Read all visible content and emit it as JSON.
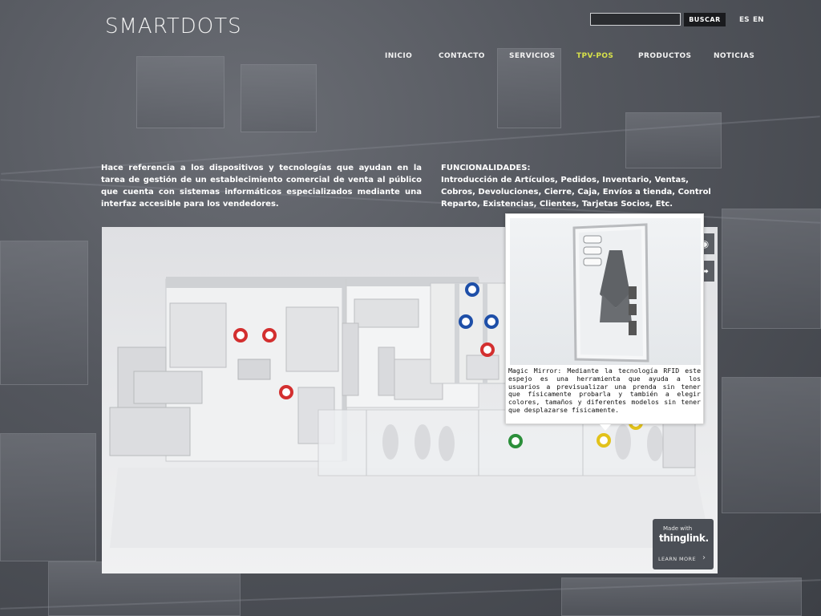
{
  "header": {
    "logo": "SMARTDOTS",
    "search": {
      "placeholder": "",
      "button_label": "BUSCAR"
    },
    "languages": [
      "ES",
      "EN"
    ]
  },
  "nav": {
    "items": [
      {
        "label": "INICIO",
        "active": false
      },
      {
        "label": "CONTACTO",
        "active": false
      },
      {
        "label": "SERVICIOS",
        "active": false
      },
      {
        "label": "TPV-POS",
        "active": true
      },
      {
        "label": "PRODUCTOS",
        "active": false
      },
      {
        "label": "NOTICIAS",
        "active": false
      }
    ]
  },
  "content": {
    "intro": "Hace referencia a los dispositivos y tecnologías que ayudan en la tarea de gestión de un establecimiento comercial de venta al público que cuenta con sistemas informáticos especializados mediante una interfaz accesible para los vendedores.",
    "features_title": "FUNCIONALIDADES:",
    "features": "Introducción de Artículos, Pedidos, Inventario, Ventas, Cobros, Devoluciones, Cierre, Caja, Envíos a tienda, Control Reparto, Existencias, Clientes, Tarjetas Socios, Etc."
  },
  "tooltip": {
    "text": "Magic Mirror: Mediante la tecnología RFID este espejo es una herramienta que ayuda a los usuarios a previsualizar una prenda sin tener que físicamente probarla y también a elegir colores, tamaños y diferentes modelos sin tener que desplazarse físicamente."
  },
  "badge": {
    "made_with": "Made with",
    "brand": "thinglink.",
    "learn_more": "LEARN MORE"
  },
  "colors": {
    "accent_nav": "#d7e14a",
    "hotspot_red": "#d32f2f",
    "hotspot_blue": "#1e4fa8",
    "hotspot_green": "#2b8f3a",
    "hotspot_yellow": "#e2c21b"
  },
  "icons": [
    "eye-icon",
    "share-icon",
    "chevron-right-icon"
  ]
}
